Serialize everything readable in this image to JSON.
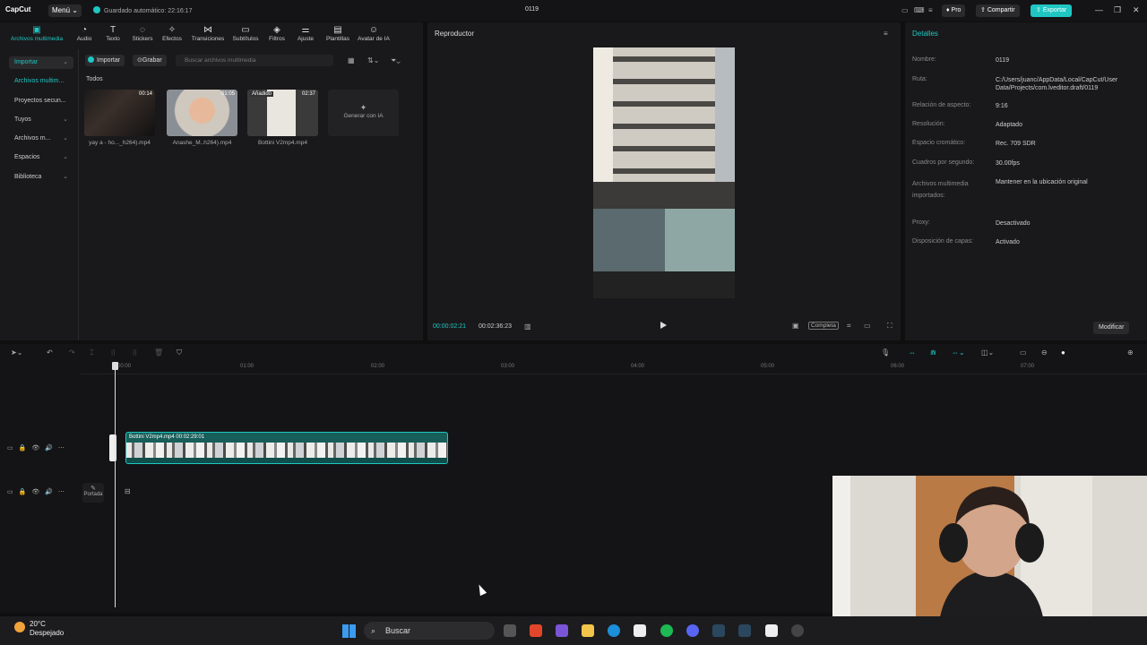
{
  "titlebar": {
    "app_name": "CapCut",
    "menu_label": "Menú",
    "autosave_text": "Guardado automático: 22:16:17",
    "project_title": "0119",
    "pro_label": "Pro",
    "share_label": "Compartir",
    "export_label": "Exportar"
  },
  "toolbar": {
    "items": [
      {
        "label": "Archivos multimedia",
        "icon": "media-icon",
        "active": true
      },
      {
        "label": "Audio",
        "icon": "audio-icon"
      },
      {
        "label": "Texto",
        "icon": "text-icon"
      },
      {
        "label": "Stickers",
        "icon": "sticker-icon"
      },
      {
        "label": "Efectos",
        "icon": "effects-icon"
      },
      {
        "label": "Transiciones",
        "icon": "transitions-icon"
      },
      {
        "label": "Subtítulos",
        "icon": "subtitles-icon"
      },
      {
        "label": "Filtros",
        "icon": "filters-icon"
      },
      {
        "label": "Ajuste",
        "icon": "adjust-icon"
      },
      {
        "label": "Plantillas",
        "icon": "templates-icon"
      },
      {
        "label": "Avatar de IA",
        "icon": "ai-avatar-icon"
      }
    ]
  },
  "sidebar": {
    "items": [
      {
        "label": "Importar"
      },
      {
        "label": "Archivos multim..."
      },
      {
        "label": "Proyectos secun..."
      },
      {
        "label": "Tuyos"
      },
      {
        "label": "Archivos m..."
      },
      {
        "label": "Espacios"
      },
      {
        "label": "Biblioteca"
      }
    ]
  },
  "media": {
    "import_label": "Importar",
    "record_label": "Grabar",
    "search_placeholder": "Buscar archivos multimedia",
    "section_label": "Todos",
    "items": [
      {
        "name": "yay a - ho..._h264).mp4",
        "duration": "00:14",
        "tag": ""
      },
      {
        "name": "Anashe_M..h264).mp4",
        "duration": "01:05",
        "tag": ""
      },
      {
        "name": "Bottini V2mp4.mp4",
        "duration": "02:37",
        "tag": "Añadido"
      }
    ],
    "generate_label": "Generar con IA"
  },
  "player": {
    "title": "Reproductor",
    "current_time": "00:00:02:21",
    "total_time": "00:02:36:23",
    "ratio_label": "Completa"
  },
  "details": {
    "title": "Detalles",
    "rows": [
      {
        "label": "Nombre:",
        "value": "0119"
      },
      {
        "label": "Ruta:",
        "value": "C:/Users/juanc/AppData/Local/CapCut/User Data/Projects/com.lveditor.draft/0119"
      },
      {
        "label": "Relación de aspecto:",
        "value": "9:16"
      },
      {
        "label": "Resolución:",
        "value": "Adaptado"
      },
      {
        "label": "Espacio cromático:",
        "value": "Rec. 709 SDR"
      },
      {
        "label": "Cuadros por segundo:",
        "value": "30.00fps"
      },
      {
        "label": "Archivos multimedia importados:",
        "value": "Mantener en la ubicación original"
      },
      {
        "label": "Proxy:",
        "value": "Desactivado"
      },
      {
        "label": "Disposición de capas:",
        "value": "Activado"
      }
    ],
    "modify_label": "Modificar"
  },
  "timeline": {
    "ruler": [
      "00:00",
      "01:00",
      "02:00",
      "03:00",
      "04:00",
      "05:00",
      "06:00",
      "07:00"
    ],
    "clip_label": "Bottini V2mp4.mp4   00:02:29:01",
    "cover_label": "Portada"
  },
  "taskbar": {
    "temperature": "20°C",
    "weather": "Despejado",
    "search_label": "Buscar"
  }
}
